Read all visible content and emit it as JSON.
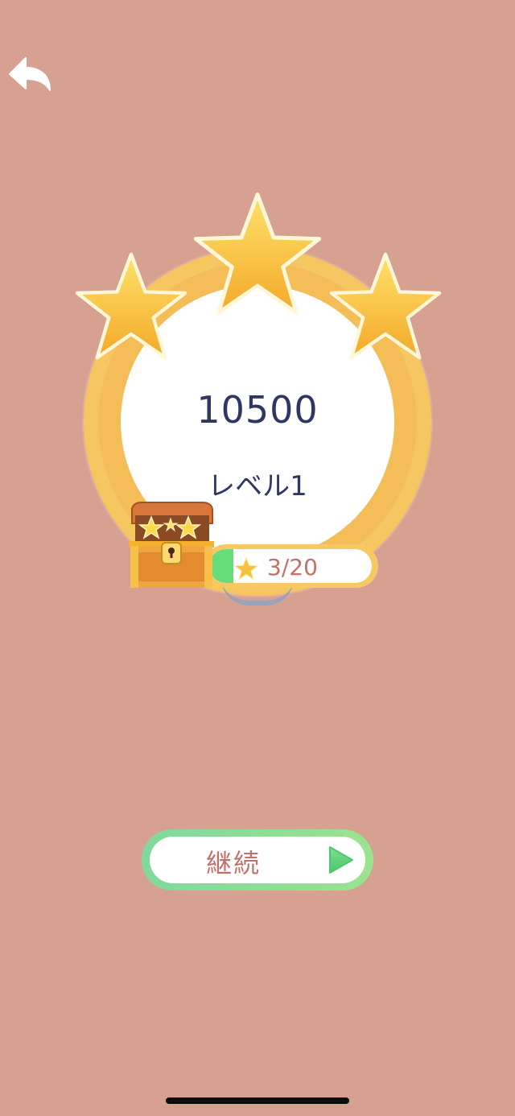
{
  "header": {
    "back_icon": "undo-arrow-icon"
  },
  "result": {
    "score": "10500",
    "level": "レベル1",
    "stars_earned": 3,
    "stars_total": 3
  },
  "reward": {
    "chest_icon": "treasure-chest-icon",
    "star_icon": "star-icon",
    "progress_text": "3/20",
    "progress_fraction": 0.15
  },
  "actions": {
    "continue_label": "継続",
    "continue_icon": "play-icon"
  },
  "colors": {
    "background": "#d6a190",
    "text_dark": "#2e3763",
    "accent_text": "#c2706a",
    "gold": "#f6c560",
    "green": "#67dc78"
  }
}
